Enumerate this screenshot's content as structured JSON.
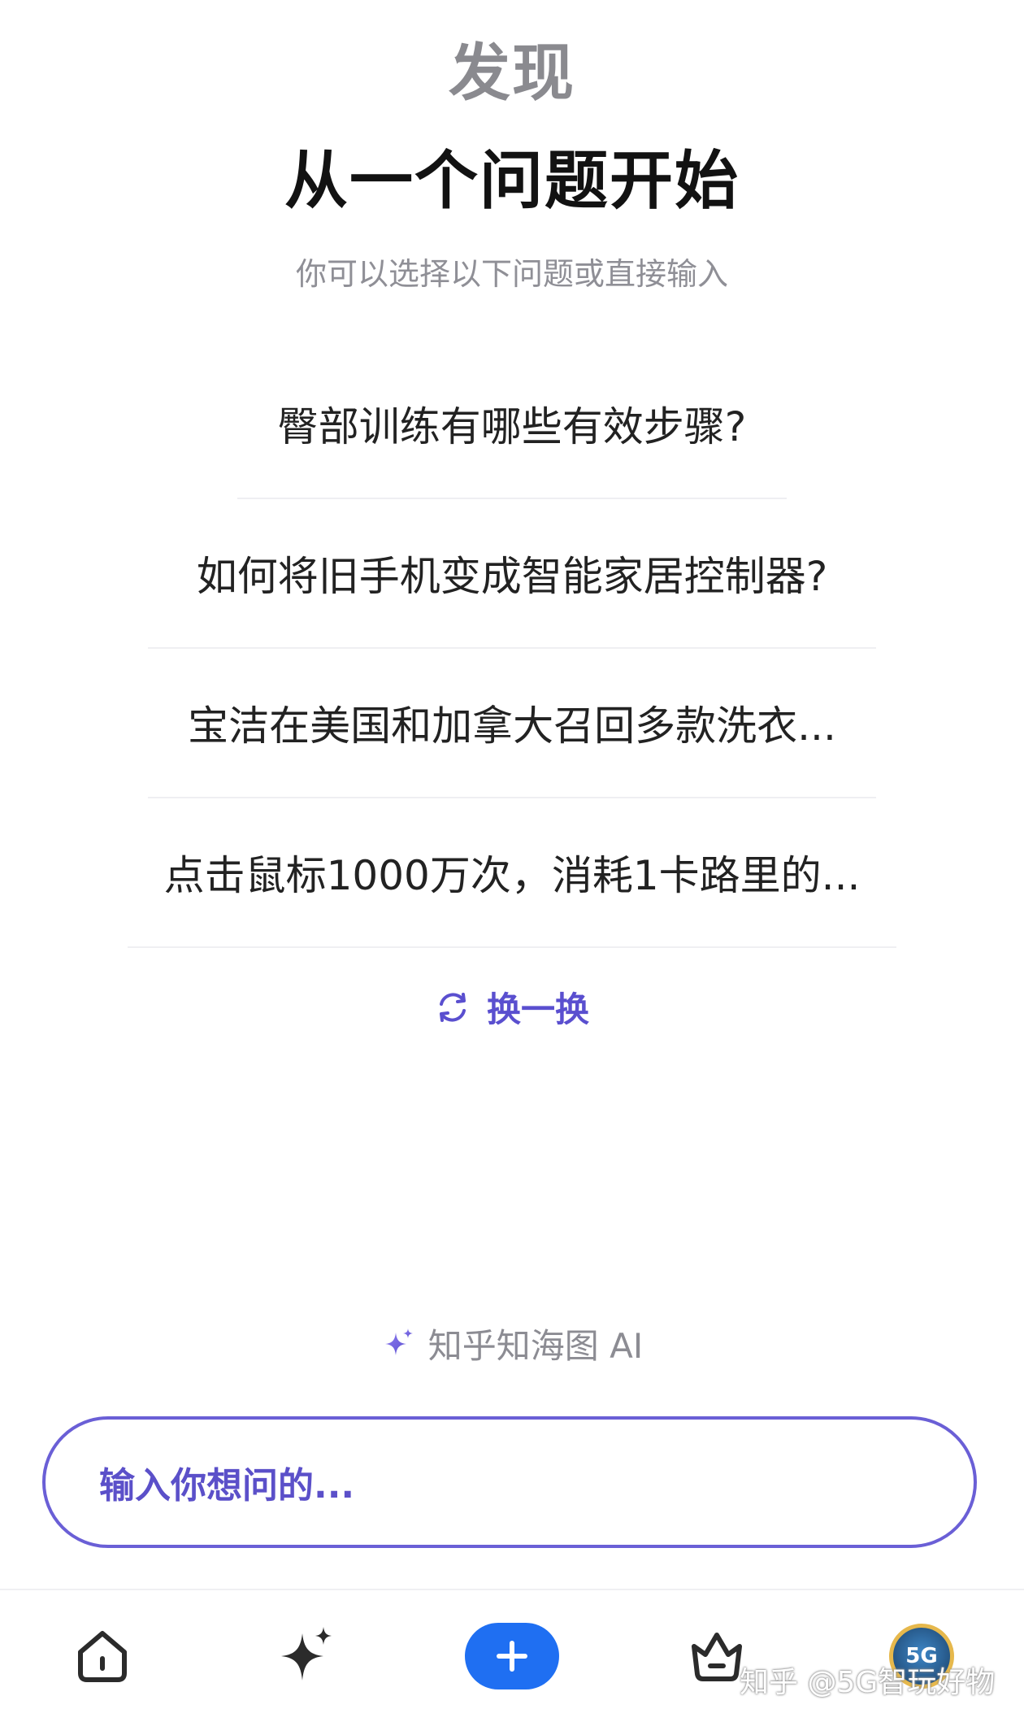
{
  "header": {
    "title": "发现",
    "headline": "从一个问题开始",
    "subtitle": "你可以选择以下问题或直接输入"
  },
  "questions": [
    "臀部训练有哪些有效步骤?",
    "如何将旧手机变成智能家居控制器?",
    "宝洁在美国和加拿大召回多款洗衣...",
    "点击鼠标1000万次，消耗1卡路里的..."
  ],
  "refresh": {
    "label": "换一换",
    "icon": "refresh-icon"
  },
  "brand": {
    "label": "知乎知海图 AI",
    "icon": "sparkle-icon"
  },
  "ask": {
    "placeholder": "输入你想问的..."
  },
  "tabbar": {
    "items": [
      {
        "icon": "home-icon"
      },
      {
        "icon": "sparkle-icon"
      },
      {
        "icon": "plus-icon"
      },
      {
        "icon": "basket-icon"
      },
      {
        "icon": "avatar",
        "text": "5G"
      }
    ]
  },
  "watermark": "知乎 @5G智玩好物",
  "colors": {
    "accent": "#5a4fcf",
    "primary_button": "#1f6ff2",
    "title_gray": "#8a8a8f"
  }
}
